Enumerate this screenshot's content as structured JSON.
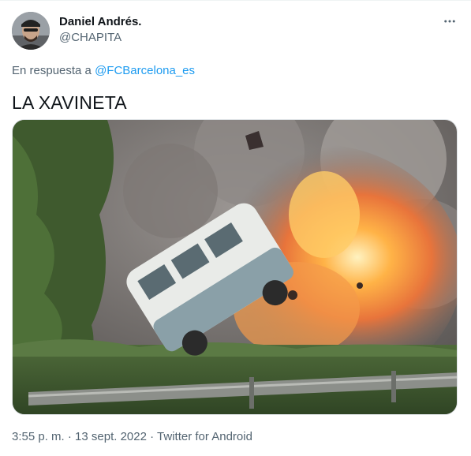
{
  "author": {
    "display_name": "Daniel Andrés.",
    "handle": "@CHAPITA"
  },
  "reply": {
    "prefix": "En respuesta a ",
    "mention": "@FCBarcelona_es"
  },
  "tweet": {
    "text": "LA XAVINETA"
  },
  "meta": {
    "time": "3:55 p. m.",
    "separator1": " · ",
    "date": "13 sept. 2022",
    "separator2": " · ",
    "source": "Twitter for Android"
  },
  "colors": {
    "primary_text": "#0f1419",
    "secondary_text": "#536471",
    "link": "#1d9bf0"
  },
  "icons": {
    "more": "more-horizontal-icon"
  }
}
